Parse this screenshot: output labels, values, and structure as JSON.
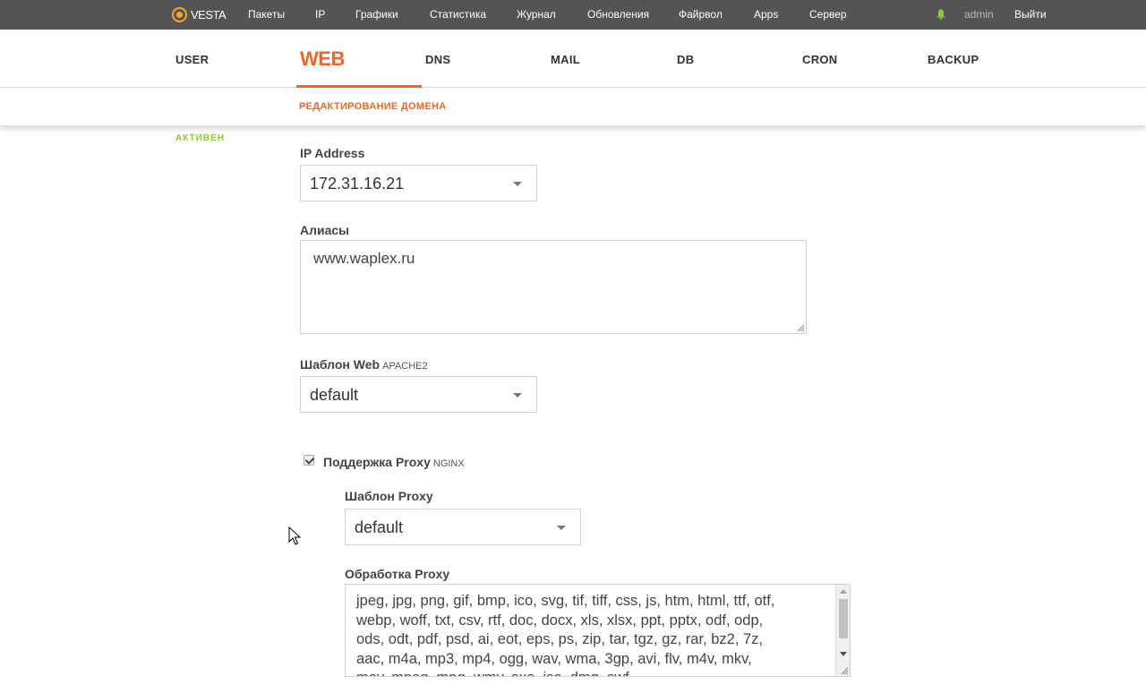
{
  "topbar": {
    "logo_text": "VESTA",
    "nav": [
      "Пакеты",
      "IP",
      "Графики",
      "Статистика",
      "Журнал",
      "Обновления",
      "Файрвол",
      "Apps",
      "Сервер"
    ],
    "user": "admin",
    "logout": "Выйти"
  },
  "tabs": [
    "USER",
    "WEB",
    "DNS",
    "MAIL",
    "DB",
    "CRON",
    "BACKUP"
  ],
  "subheader": {
    "title": "РЕДАКТИРОВАНИЕ ДОМЕНА"
  },
  "status": "АКТИВЕН",
  "form": {
    "ip_label": "IP Address",
    "ip_value": "172.31.16.21",
    "aliases_label": "Алиасы",
    "aliases_value": "www.waplex.ru",
    "web_template_label": "Шаблон Web",
    "web_template_hint": "APACHE2",
    "web_template_value": "default",
    "proxy_support_label": "Поддержка Proxy",
    "proxy_support_hint": "NGINX",
    "proxy_support_checked": true,
    "proxy_template_label": "Шаблон Proxy",
    "proxy_template_value": "default",
    "proxy_ext_label": "Обработка Proxy",
    "proxy_ext_value": "jpeg, jpg, png, gif, bmp, ico, svg, tif, tiff, css, js, htm, html, ttf, otf,\nwebp, woff, txt, csv, rtf, doc, docx, xls, xlsx, ppt, pptx, odf, odp,\nods, odt, pdf, psd, ai, eot, eps, ps, zip, tar, tgz, gz, rar, bz2, 7z,\naac, m4a, mp3, mp4, ogg, wav, wma, 3gp, avi, flv, m4v, mkv,\nmov, mpeg, mpg, wmv, exe, iso, dmg, swf"
  },
  "colors": {
    "accent": "#f26522",
    "active_status": "#8cc63f",
    "topbar_bg": "#545454"
  }
}
